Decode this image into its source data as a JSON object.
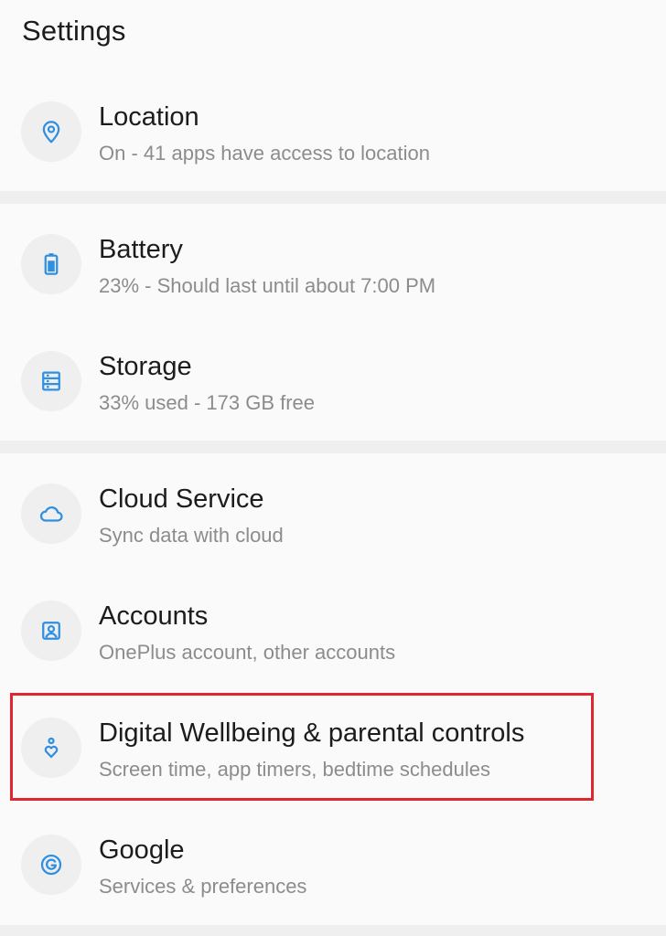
{
  "header": {
    "title": "Settings"
  },
  "settings": {
    "items": [
      {
        "title": "Location",
        "subtitle": "On - 41 apps have access to location",
        "icon": "location-pin-icon"
      },
      {
        "title": "Battery",
        "subtitle": "23% - Should last until about 7:00 PM",
        "icon": "battery-icon"
      },
      {
        "title": "Storage",
        "subtitle": "33% used - 173 GB free",
        "icon": "storage-icon"
      },
      {
        "title": "Cloud Service",
        "subtitle": "Sync data with cloud",
        "icon": "cloud-icon"
      },
      {
        "title": "Accounts",
        "subtitle": "OnePlus account, other accounts",
        "icon": "account-icon"
      },
      {
        "title": "Digital Wellbeing & parental controls",
        "subtitle": "Screen time, app timers, bedtime schedules",
        "icon": "wellbeing-icon",
        "highlighted": true
      },
      {
        "title": "Google",
        "subtitle": "Services & preferences",
        "icon": "google-icon"
      }
    ]
  },
  "colors": {
    "accent": "#2f8fe0",
    "highlight": "#e0262f",
    "icon_background": "#efefef",
    "divider": "#efefef"
  }
}
